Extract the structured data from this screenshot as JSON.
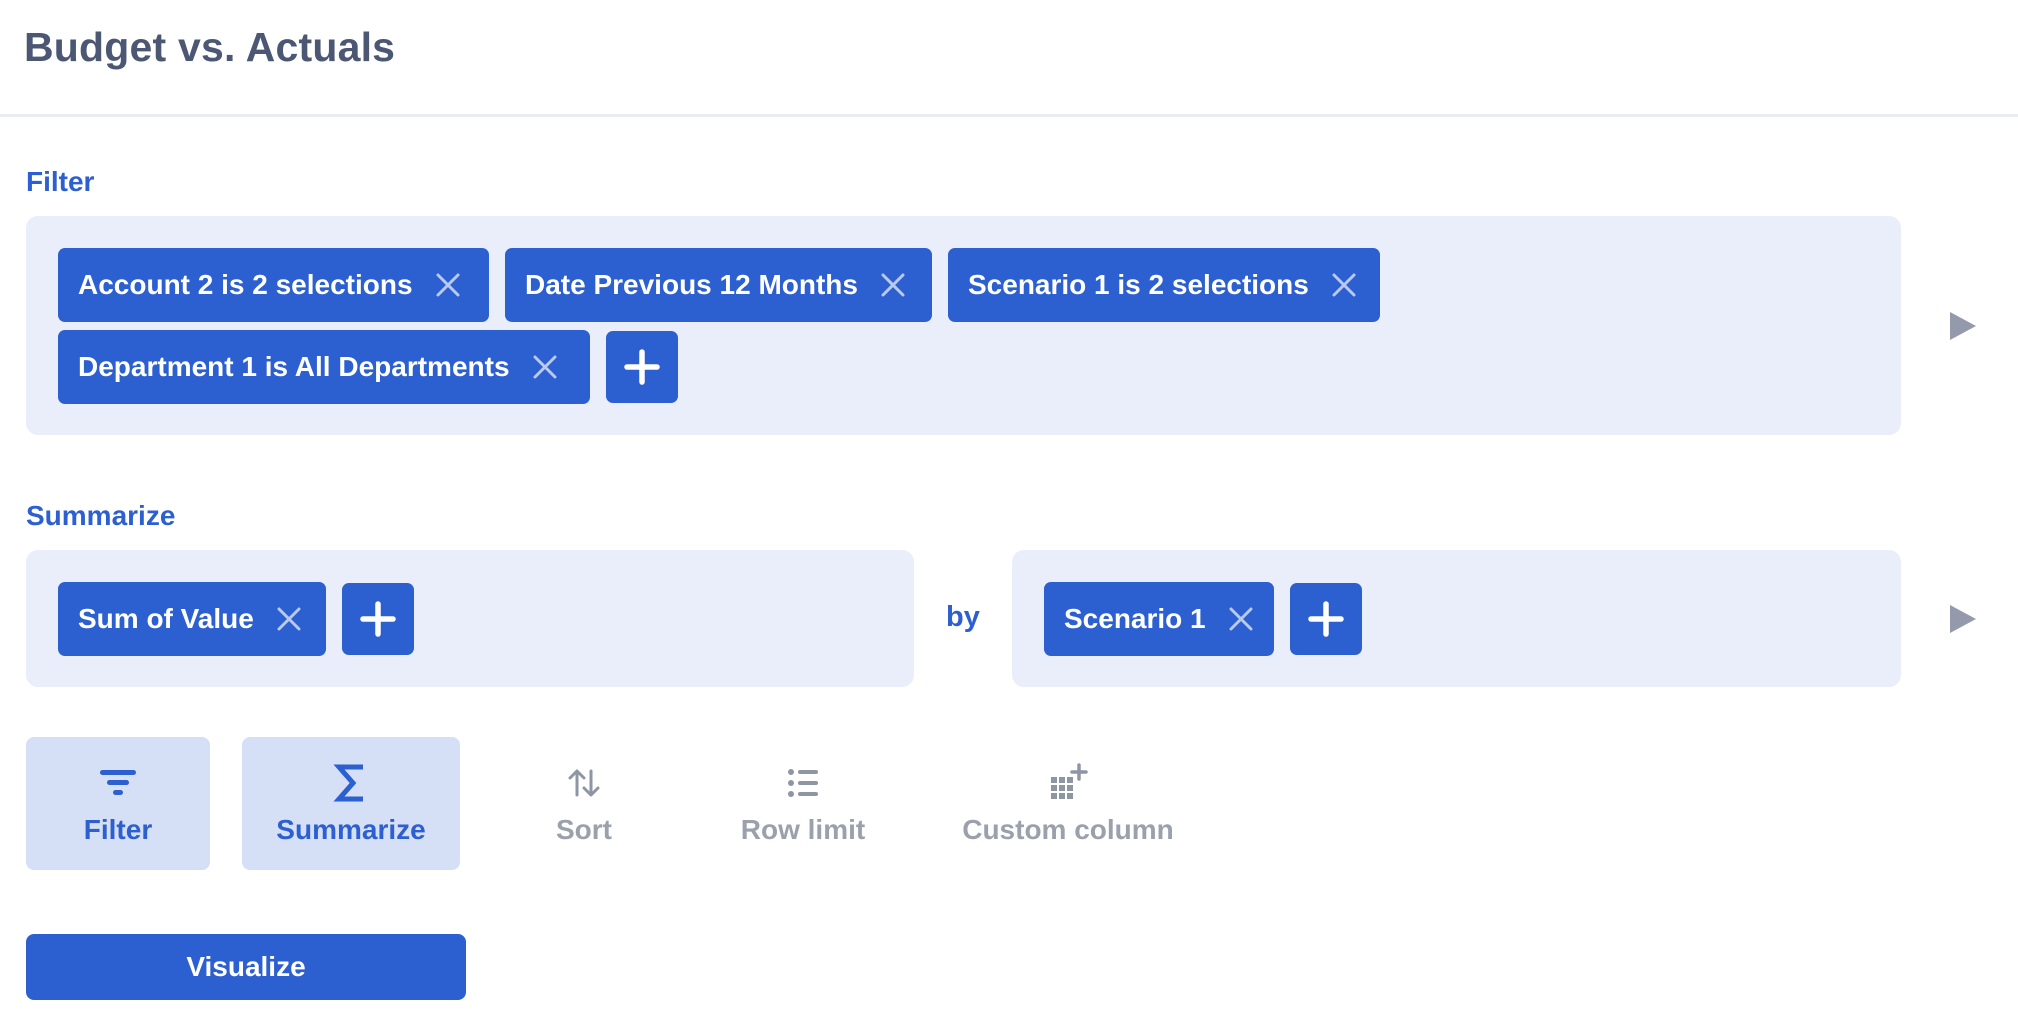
{
  "page": {
    "title": "Budget vs. Actuals"
  },
  "filter": {
    "label": "Filter",
    "chips": [
      {
        "label": "Account 2 is 2 selections"
      },
      {
        "label": "Date Previous 12 Months"
      },
      {
        "label": "Scenario 1 is 2 selections"
      },
      {
        "label": "Department 1 is All Departments"
      }
    ]
  },
  "summarize": {
    "label": "Summarize",
    "metrics": [
      {
        "label": "Sum of Value"
      }
    ],
    "by_label": "by",
    "groupings": [
      {
        "label": "Scenario 1"
      }
    ]
  },
  "actions": [
    {
      "label": "Filter",
      "icon": "filter-icon",
      "active": true
    },
    {
      "label": "Summarize",
      "icon": "sigma-icon",
      "active": true
    },
    {
      "label": "Sort",
      "icon": "sort-icon",
      "active": false
    },
    {
      "label": "Row limit",
      "icon": "list-icon",
      "active": false
    },
    {
      "label": "Custom column",
      "icon": "custom-column-icon",
      "active": false
    }
  ],
  "visualize_button": {
    "label": "Visualize"
  },
  "colors": {
    "primary": "#2c5fcf",
    "panel_bg": "#e9eefa",
    "active_action_bg": "#d5dff6",
    "title": "#4c5773",
    "muted": "#9aa1ad",
    "run_arrow": "#949aab"
  }
}
